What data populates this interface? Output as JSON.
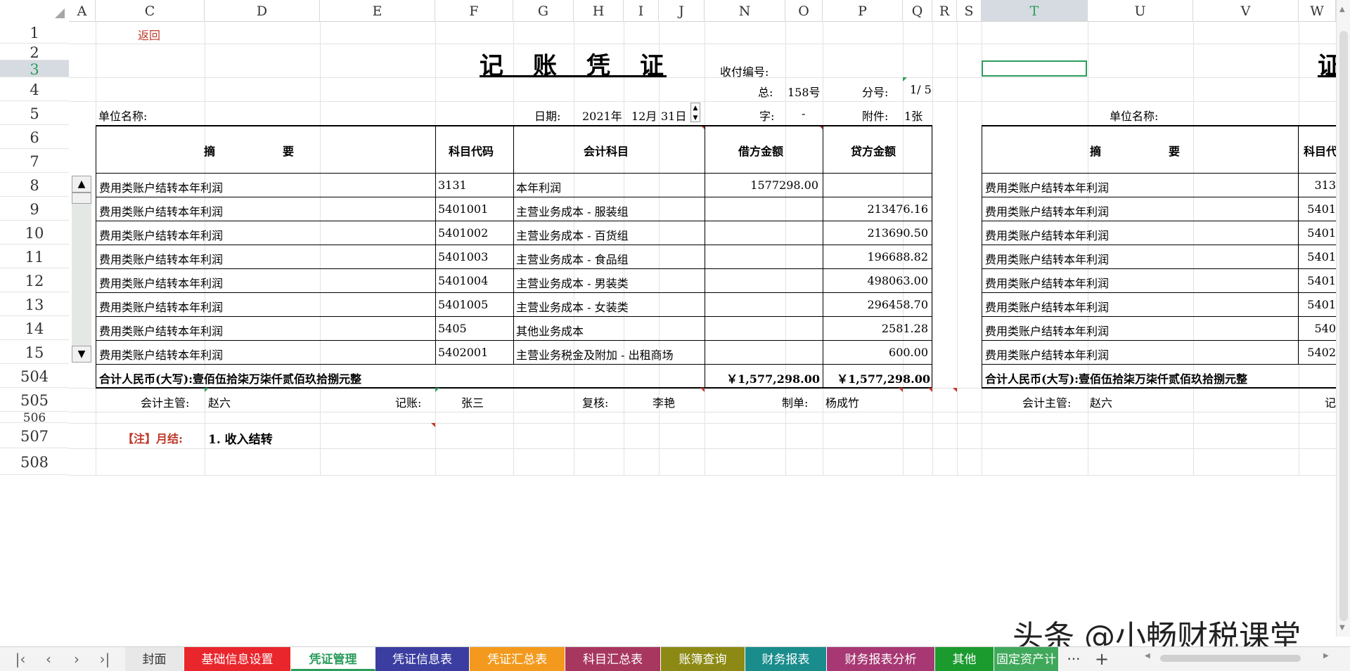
{
  "columns": [
    "A",
    "C",
    "D",
    "E",
    "F",
    "G",
    "H",
    "I",
    "J",
    "N",
    "O",
    "P",
    "Q",
    "R",
    "S",
    "T",
    "U",
    "V",
    "W"
  ],
  "rows": [
    "1",
    "2",
    "3",
    "4",
    "5",
    "6",
    "7",
    "8",
    "9",
    "10",
    "11",
    "12",
    "13",
    "14",
    "15",
    "504",
    "505",
    "506",
    "507",
    "508"
  ],
  "back_link": "返回",
  "voucher": {
    "title": "记　账　凭　证",
    "title_partial": "证",
    "pay_no_label": "收付编号:",
    "total_label": "总:",
    "total_value": "158号",
    "sub_label": "分号:",
    "sub_value": "1/ 5",
    "unit_label": "单位名称:",
    "date_label": "日期:",
    "year": "2021年",
    "month": "12月",
    "day": "31日",
    "word_label": "字:",
    "word_value": "-",
    "attach_label": "附件:",
    "attach_value": "1张",
    "headers": {
      "summary": "摘　　　　　　要",
      "code": "科目代码",
      "account": "会计科目",
      "debit": "借方金额",
      "credit": "贷方金额",
      "code_partial": "科目代"
    },
    "entries": [
      {
        "summary": "费用类账户结转本年利润",
        "code": "3131",
        "account": "本年利润",
        "debit": "1577298.00",
        "credit": "",
        "code_partial": "313"
      },
      {
        "summary": "费用类账户结转本年利润",
        "code": "5401001",
        "account": "主营业务成本 - 服装组",
        "debit": "",
        "credit": "213476.16",
        "code_partial": "5401"
      },
      {
        "summary": "费用类账户结转本年利润",
        "code": "5401002",
        "account": "主营业务成本 - 百货组",
        "debit": "",
        "credit": "213690.50",
        "code_partial": "5401"
      },
      {
        "summary": "费用类账户结转本年利润",
        "code": "5401003",
        "account": "主营业务成本 - 食品组",
        "debit": "",
        "credit": "196688.82",
        "code_partial": "5401"
      },
      {
        "summary": "费用类账户结转本年利润",
        "code": "5401004",
        "account": "主营业务成本 - 男装类",
        "debit": "",
        "credit": "498063.00",
        "code_partial": "5401"
      },
      {
        "summary": "费用类账户结转本年利润",
        "code": "5401005",
        "account": "主营业务成本 - 女装类",
        "debit": "",
        "credit": "296458.70",
        "code_partial": "5401"
      },
      {
        "summary": "费用类账户结转本年利润",
        "code": "5405",
        "account": "其他业务成本",
        "debit": "",
        "credit": "2581.28",
        "code_partial": "540"
      },
      {
        "summary": "费用类账户结转本年利润",
        "code": "5402001",
        "account": "主营业务税金及附加 - 出租商场",
        "debit": "",
        "credit": "600.00",
        "code_partial": "5402"
      }
    ],
    "total_text": "合计人民币(大写):壹佰伍拾柒万柒仟贰佰玖拾捌元整",
    "total_debit": "￥1,577,298.00",
    "total_credit": "￥1,577,298.00",
    "supervisor_label": "会计主管:",
    "supervisor": "赵六",
    "bookkeeper_label": "记账:",
    "bookkeeper": "张三",
    "reviewer_label": "复核:",
    "reviewer": "李艳",
    "maker_label": "制单:",
    "maker": "杨成竹",
    "bookkeeper_partial": "记"
  },
  "note": {
    "label": "【注】月结:",
    "text": "1. 收入结转"
  },
  "tabs": [
    {
      "label": "封面",
      "color": "#e8e8e8"
    },
    {
      "label": "基础信息设置",
      "color": "#e8262c"
    },
    {
      "label": "凭证管理",
      "color": "#ffffff"
    },
    {
      "label": "凭证信息表",
      "color": "#3b3ea0"
    },
    {
      "label": "凭证汇总表",
      "color": "#f39a1e"
    },
    {
      "label": "科目汇总表",
      "color": "#a7375f"
    },
    {
      "label": "账簿查询",
      "color": "#8c8a14"
    },
    {
      "label": "财务报表",
      "color": "#1a8c8c"
    },
    {
      "label": "财务报表分析",
      "color": "#a73873"
    },
    {
      "label": "其他",
      "color": "#1b9a2e"
    },
    {
      "label": "固定资产计",
      "color": "#3fa85a"
    }
  ],
  "tab_more": "···",
  "tab_add": "+",
  "watermark": "头条 @小畅财税课堂"
}
